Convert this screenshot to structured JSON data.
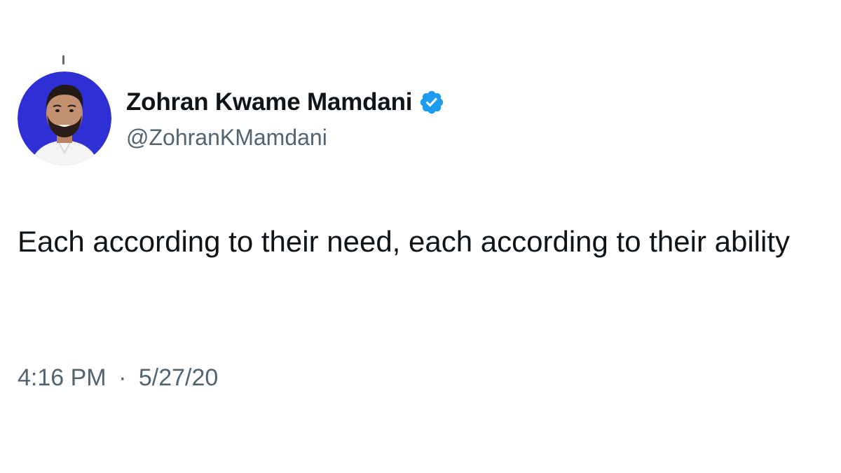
{
  "tweet": {
    "author": {
      "display_name": "Zohran Kwame Mamdani",
      "handle": "@ZohranKMamdani",
      "verified": true,
      "verified_badge_icon": "verified-badge-icon",
      "avatar_icon": "avatar-photo",
      "avatar_background_color": "#2f2fd6"
    },
    "text": "Each according to their need, each according to their ability",
    "time": "4:16 PM",
    "separator": "·",
    "date": "5/27/20"
  },
  "colors": {
    "primary_text": "#0f1419",
    "secondary_text": "#536471",
    "verified_blue": "#1d9bf0",
    "background": "#ffffff"
  }
}
